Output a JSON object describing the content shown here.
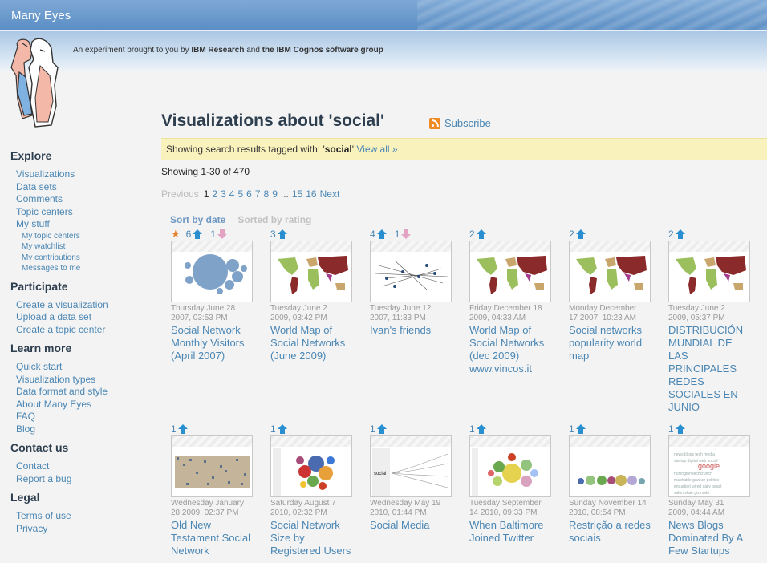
{
  "header": {
    "app_title": "Many Eyes",
    "tagline_prefix": "An experiment brought to you by ",
    "tagline_org1": "IBM Research",
    "tagline_and": " and ",
    "tagline_org2": "the IBM Cognos software group"
  },
  "sidebar": {
    "explore": {
      "heading": "Explore",
      "items": [
        "Visualizations",
        "Data sets",
        "Comments",
        "Topic centers",
        "My stuff"
      ],
      "sub_items": [
        "My topic centers",
        "My watchlist",
        "My contributions",
        "Messages to me"
      ]
    },
    "participate": {
      "heading": "Participate",
      "items": [
        "Create a visualization",
        "Upload a data set",
        "Create a topic center"
      ]
    },
    "learn": {
      "heading": "Learn more",
      "items": [
        "Quick start",
        "Visualization types",
        "Data format and style",
        "About Many Eyes",
        "FAQ",
        "Blog"
      ]
    },
    "contact": {
      "heading": "Contact us",
      "items": [
        "Contact",
        "Report a bug"
      ]
    },
    "legal": {
      "heading": "Legal",
      "items": [
        "Terms of use",
        "Privacy"
      ]
    }
  },
  "main": {
    "title": "Visualizations about 'social'",
    "subscribe": "Subscribe",
    "filter_prefix": "Showing search results tagged with: '",
    "filter_tag": "social",
    "filter_suffix": "'",
    "view_all": "View all »",
    "showing": "Showing 1-30 of 470",
    "pager": {
      "previous": "Previous",
      "current": "1",
      "pages": [
        "2",
        "3",
        "4",
        "5",
        "6",
        "7",
        "8",
        "9"
      ],
      "ellipsis": "...",
      "tail_pages": [
        "15",
        "16"
      ],
      "next": "Next"
    },
    "sort_by_date": "Sort by date",
    "sort_by_rating": "Sorted by rating"
  },
  "cards": [
    {
      "star": true,
      "up": "6",
      "down": "1",
      "date1": "Thursday June 28",
      "date2": "2007, 03:53 PM",
      "title": [
        "Social Network",
        "Monthly Visitors",
        "(April 2007)"
      ],
      "thumb": "bubble"
    },
    {
      "up": "3",
      "date1": "Tuesday June 2",
      "date2": "2009, 03:42 PM",
      "title": [
        "World Map of",
        "Social Networks",
        "(June 2009)"
      ],
      "thumb": "map"
    },
    {
      "up": "4",
      "down": "1",
      "date1": "Tuesday June 12",
      "date2": "2007, 11:33 PM",
      "title": [
        "Ivan's friends"
      ],
      "thumb": "network"
    },
    {
      "up": "2",
      "date1": "Friday December 18",
      "date2": "2009, 04:33 AM",
      "title": [
        "World Map of",
        "Social Networks",
        "(dec 2009)",
        "www.vincos.it"
      ],
      "thumb": "map"
    },
    {
      "up": "2",
      "date1": "Monday December",
      "date2": "17 2007, 10:23 AM",
      "title": [
        "Social networks",
        "popularity world",
        "map"
      ],
      "thumb": "map"
    },
    {
      "up": "2",
      "date1": "Tuesday June 2",
      "date2": "2009, 05:37 PM",
      "title": [
        "DISTRIBUCIÓN",
        "MUNDIAL DE",
        "LAS",
        "PRINCIPALES",
        "REDES",
        "SOCIALES EN",
        "JUNIO"
      ],
      "thumb": "map"
    },
    {
      "up": "1",
      "date1": "Wednesday January",
      "date2": "28 2009, 02:37 PM",
      "title": [
        "Old New",
        "Testament Social",
        "Network"
      ],
      "thumb": "noise"
    },
    {
      "up": "1",
      "date1": "Saturday August 7",
      "date2": "2010, 02:32 PM",
      "title": [
        "Social Network",
        "Size by",
        "Registered Users"
      ],
      "thumb": "bubblecolor"
    },
    {
      "up": "1",
      "date1": "Wednesday May 19",
      "date2": "2010, 01:44 PM",
      "title": [
        "Social Media"
      ],
      "thumb": "wordtree"
    },
    {
      "up": "1",
      "date1": "Tuesday September",
      "date2": "14 2010, 09:33 PM",
      "title": [
        "When Baltimore",
        "Joined Twitter"
      ],
      "thumb": "bubblecolor2"
    },
    {
      "up": "1",
      "date1": "Sunday November 14",
      "date2": "2010, 08:54 PM",
      "title": [
        "Restrição a redes",
        "sociais"
      ],
      "thumb": "bubblerow"
    },
    {
      "up": "1",
      "date1": "Sunday May 31",
      "date2": "2009, 04:44 AM",
      "title": [
        "News Blogs",
        "Dominated By A",
        "Few Startups"
      ],
      "thumb": "tagcloud"
    }
  ],
  "colors": {
    "accent": "#4a86b4",
    "header": "#5b8ec4",
    "filter_bg": "#faf2bd",
    "upvote": "#2a8fd0",
    "downvote": "#e3a4c4",
    "star": "#e8802a"
  }
}
